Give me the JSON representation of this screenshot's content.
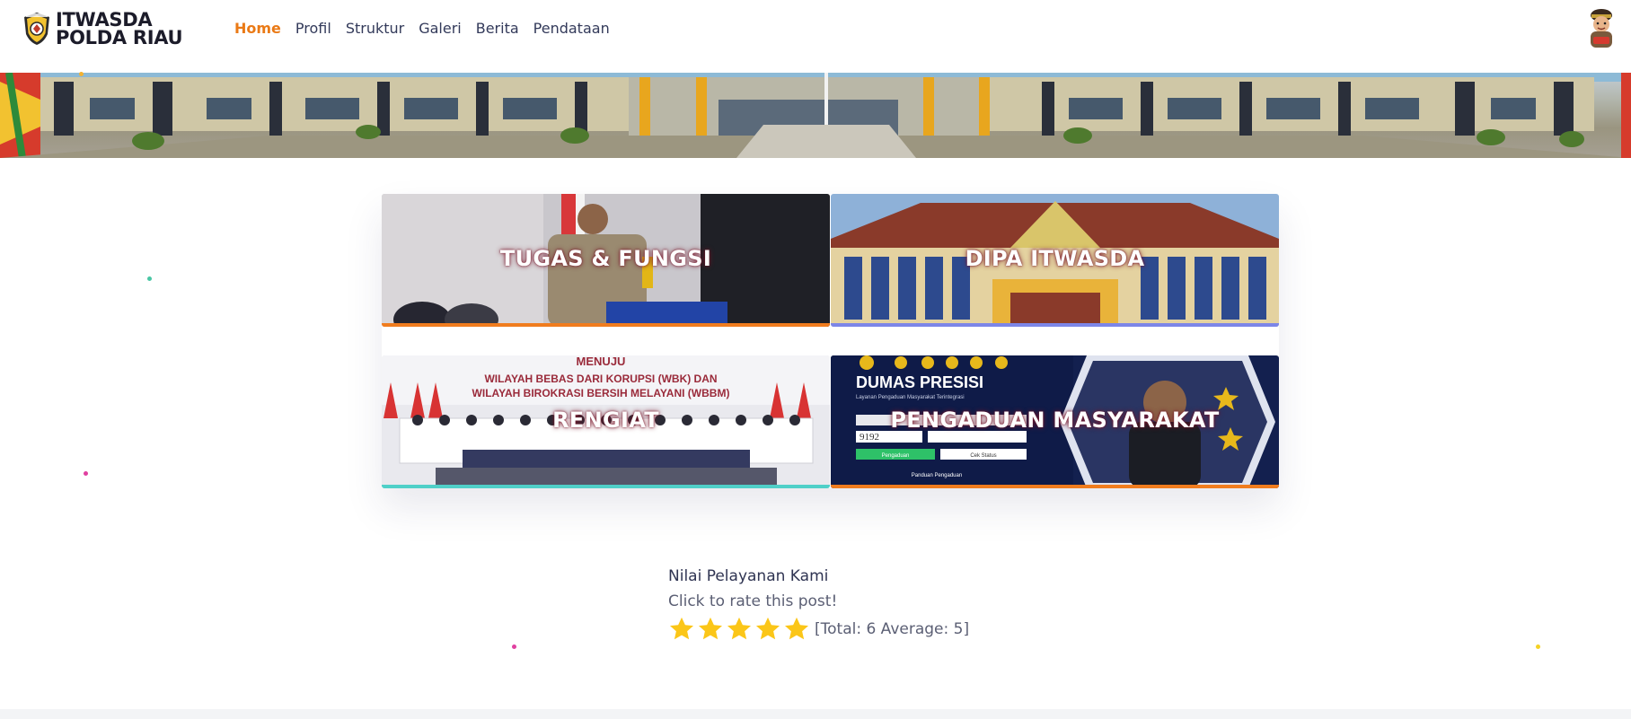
{
  "header": {
    "logo": {
      "line1": "ITWASDA",
      "line2": "POLDA RIAU"
    },
    "nav": [
      {
        "label": "Home",
        "active": true
      },
      {
        "label": "Profil",
        "active": false
      },
      {
        "label": "Struktur",
        "active": false
      },
      {
        "label": "Galeri",
        "active": false
      },
      {
        "label": "Berita",
        "active": false
      },
      {
        "label": "Pendataan",
        "active": false
      }
    ],
    "mascot_icon": "police-mascot-icon"
  },
  "cards": [
    {
      "label": "TUGAS & FUNGSI",
      "underline_color": "#f07c1e"
    },
    {
      "label": "DIPA ITWASDA",
      "underline_color": "#7c86e8"
    },
    {
      "label": "RENGIAT",
      "underline_color": "#4fd0c8",
      "banner_text": [
        "MENUJU",
        "WILAYAH BEBAS DARI KORUPSI (WBK) DAN",
        "WILAYAH BIROKRASI BERSIH MELAYANI (WBBM)"
      ]
    },
    {
      "label": "PENGADUAN MASYARAKAT",
      "underline_color": "#f07c1e",
      "poster": {
        "title": "DUMAS PRESISI",
        "subtitle": "Layanan Pengaduan Masyarakat Terintegrasi",
        "captcha": "9192",
        "btn1": "Pengaduan",
        "btn2": "Cek Status",
        "footer": "Panduan Pengaduan"
      }
    }
  ],
  "rating": {
    "title": "Nilai Pelayanan Kami",
    "subtitle": "Click to rate this post!",
    "stars": 5,
    "total_text": "[Total: 6 Average: 5]",
    "star_color": "#fbc618"
  },
  "colors": {
    "accent": "#ea7a16",
    "nav_text": "#333a5a"
  }
}
